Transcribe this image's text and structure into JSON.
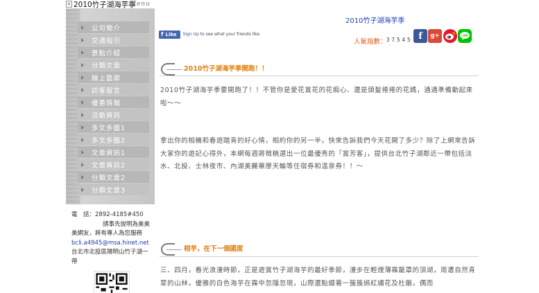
{
  "banner": {
    "alt_text": "2010竹子湖海芋季",
    "menu_script": "Menu"
  },
  "menu": {
    "items": [
      {
        "label": "公司簡介"
      },
      {
        "label": "交通指引"
      },
      {
        "label": "景點介紹"
      },
      {
        "label": "分類文章"
      },
      {
        "label": "線上藝廊"
      },
      {
        "label": "訪客留言"
      },
      {
        "label": "優惠情報"
      },
      {
        "label": "活動資訊"
      },
      {
        "label": "多文多圖1"
      },
      {
        "label": "多文多圖2"
      },
      {
        "label": "文章資訊1"
      },
      {
        "label": "文章資訊2"
      },
      {
        "label": "分類文章2"
      },
      {
        "label": "分類文章3"
      }
    ]
  },
  "contact": {
    "phone": "電　話：2892-4185#450",
    "note_line1": "請事先說明為美美",
    "note_line2": "美網友，將有專人為您服務",
    "email": "bcli.a4945@msa.hinet.net",
    "address_line1": "台北市北投區陽明山竹子湖一",
    "address_line2": "帶"
  },
  "header": {
    "site_title": "2010竹子湖海芋季",
    "popularity_label": "人氣指數：",
    "popularity_count": "37545"
  },
  "facebook": {
    "like_label": "Like",
    "signup_link": "Sign Up",
    "signup_text": " to see what your friends like."
  },
  "social": [
    {
      "icon": "facebook-icon",
      "glyph": "f",
      "color": "#3b5998"
    },
    {
      "icon": "google-plus-icon",
      "glyph": "g+",
      "color": "#d94a38"
    },
    {
      "icon": "weibo-icon",
      "glyph": "",
      "color": "#e6162d"
    },
    {
      "icon": "line-icon",
      "glyph": "LINE",
      "color": "#00c300"
    }
  ],
  "posts": [
    {
      "title": "2010竹子湖海芋季開跑！！",
      "paragraphs": [
        "2010竹子湖海芋季要開跑了！！不管你是愛花賞花的花痴心、還是頭髮捲捲的花媽，通通準備動起來啦～～",
        "拿出你的相機和春遊踏青的好心情，相約你的另一半，快來告訴我們今天花開了多少？除了上網來告訴大家你的遊記心得外，本網每週將徵稿選出一位最優秀的「賞芳客」，提供台北竹子湖鄰近一帶包括淡水、北投、士林夜市、內湖美麗華摩天輪等住宿券和溫泉券！！～"
      ]
    },
    {
      "title": "相芋，在下一個國度",
      "paragraphs": [
        "三、四月，春光浪漫時節，正是遊賞竹子湖海芋的最好季節，漫步在輕煙薄霧籠罩的頂湖，周遭自然青翠的山林，優雅的白色海芋在霧中忽隱忽現，山際還點綴著一簇簇嫣紅繡花及杜鵑，偶而"
      ]
    }
  ]
}
